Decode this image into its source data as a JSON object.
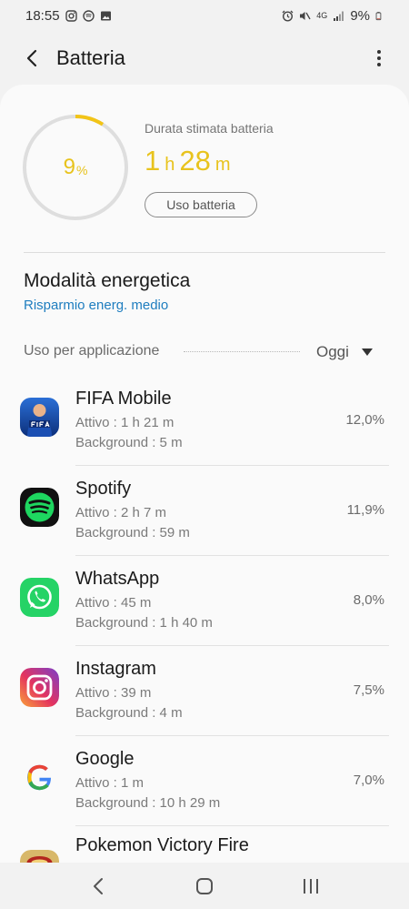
{
  "status_bar": {
    "time": "18:55",
    "battery": "9%",
    "network": "4G",
    "left_icons": [
      "instagram-icon",
      "spotify-notification-icon",
      "gallery-icon"
    ],
    "right_icons": [
      "alarm-icon",
      "vibrate-mute-icon",
      "signal-icon",
      "battery-icon"
    ]
  },
  "app_bar": {
    "title": "Batteria",
    "back_icon": "back-chevron-icon",
    "more_icon": "more-vert-icon"
  },
  "battery": {
    "level_value": 9,
    "level_unit": "%",
    "ring_color": "#f2c417",
    "estimated_label": "Durata stimata batteria",
    "hours": "1",
    "hours_unit": "h",
    "minutes": "28",
    "minutes_unit": "m",
    "usage_button": "Uso batteria"
  },
  "power_mode": {
    "title": "Modalità energetica",
    "subtitle": "Risparmio energ. medio"
  },
  "usage": {
    "label": "Uso per applicazione",
    "period": "Oggi"
  },
  "apps": [
    {
      "name": "FIFA Mobile",
      "active": "Attivo : 1 h 21 m",
      "background": "Background : 5 m",
      "percent": "12,0%",
      "icon": "fifa-mobile-icon"
    },
    {
      "name": "Spotify",
      "active": "Attivo : 2 h 7 m",
      "background": "Background : 59 m",
      "percent": "11,9%",
      "icon": "spotify-icon"
    },
    {
      "name": "WhatsApp",
      "active": "Attivo : 45 m",
      "background": "Background : 1 h 40 m",
      "percent": "8,0%",
      "icon": "whatsapp-icon"
    },
    {
      "name": "Instagram",
      "active": "Attivo : 39 m",
      "background": "Background : 4 m",
      "percent": "7,5%",
      "icon": "instagram-icon"
    },
    {
      "name": "Google",
      "active": "Attivo : 1 m",
      "background": "Background : 10 h 29 m",
      "percent": "7,0%",
      "icon": "google-icon"
    },
    {
      "name": "Pokemon Victory Fire",
      "active": "",
      "background": "",
      "percent": "",
      "icon": "pokemon-icon"
    }
  ],
  "nav": {
    "back": "nav-back-icon",
    "home": "nav-home-icon",
    "recents": "nav-recents-icon"
  }
}
